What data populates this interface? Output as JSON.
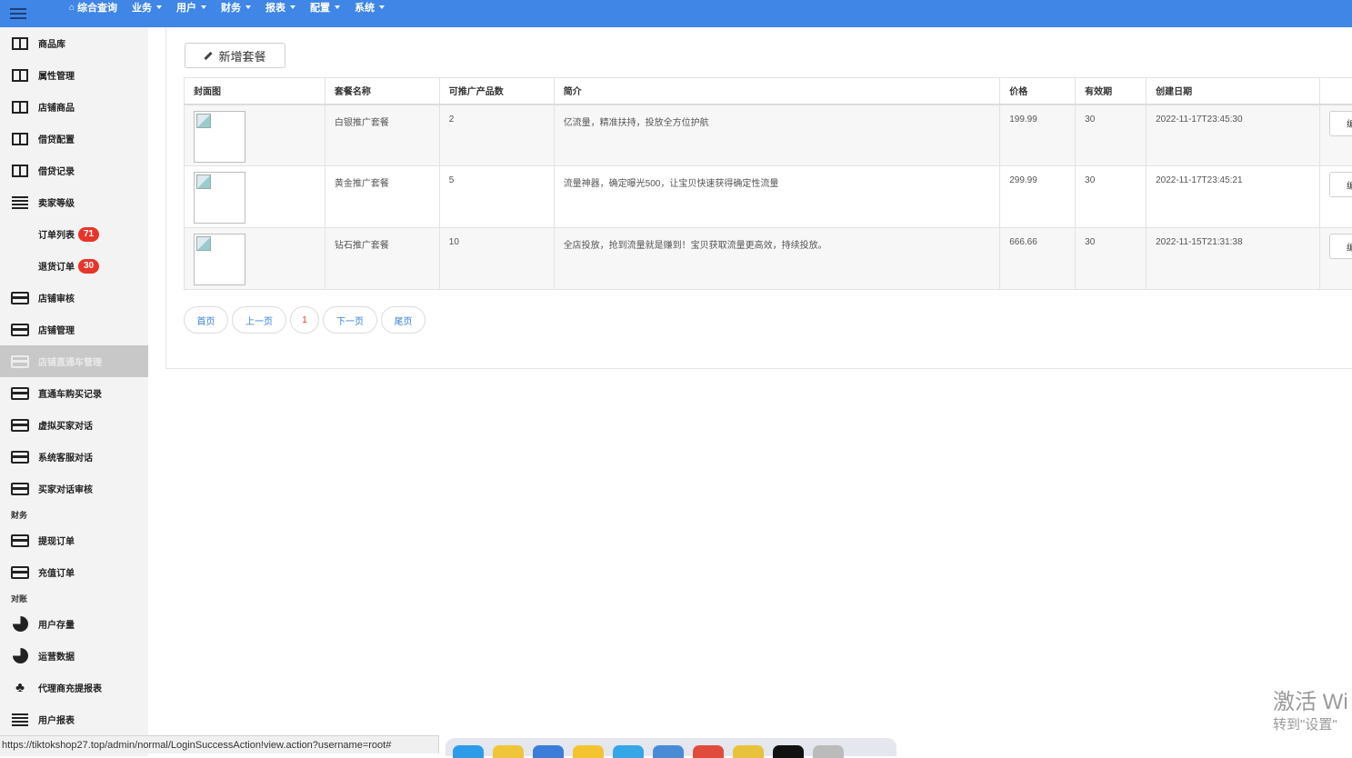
{
  "topnav": {
    "items": [
      {
        "label": "综合查询",
        "has_home_icon": true,
        "has_caret": false
      },
      {
        "label": "业务",
        "has_caret": true
      },
      {
        "label": "用户",
        "has_caret": true
      },
      {
        "label": "财务",
        "has_caret": true
      },
      {
        "label": "报表",
        "has_caret": true
      },
      {
        "label": "配置",
        "has_caret": true
      },
      {
        "label": "系统",
        "has_caret": true
      }
    ]
  },
  "sidebar": {
    "items": [
      {
        "label": "商品库",
        "icon": "book-icon"
      },
      {
        "label": "属性管理",
        "icon": "book-icon"
      },
      {
        "label": "店铺商品",
        "icon": "book-icon"
      },
      {
        "label": "借贷配置",
        "icon": "book-icon"
      },
      {
        "label": "借贷记录",
        "icon": "book-icon"
      },
      {
        "label": "卖家等级",
        "icon": "list-icon"
      },
      {
        "label": "订单列表",
        "badge": "71"
      },
      {
        "label": "退货订单",
        "badge": "30"
      },
      {
        "label": "店铺审核",
        "icon": "card-icon"
      },
      {
        "label": "店铺管理",
        "icon": "card-icon"
      },
      {
        "label": "店铺直通车管理",
        "icon": "card-icon",
        "active": true
      },
      {
        "label": "直通车购买记录",
        "icon": "card-icon"
      },
      {
        "label": "虚拟买家对话",
        "icon": "card-icon"
      },
      {
        "label": "系统客服对话",
        "icon": "card-icon"
      },
      {
        "label": "买家对话审核",
        "icon": "card-icon"
      },
      {
        "section": "财务"
      },
      {
        "label": "提现订单",
        "icon": "card-icon"
      },
      {
        "label": "充值订单",
        "icon": "card-icon"
      },
      {
        "section": "对账"
      },
      {
        "label": "用户存量",
        "icon": "pie-icon"
      },
      {
        "label": "运营数据",
        "icon": "pie-icon"
      },
      {
        "label": "代理商充提报表",
        "icon": "sitemap-icon"
      },
      {
        "label": "用户报表",
        "icon": "list-icon"
      }
    ]
  },
  "toolbar": {
    "add_label": "新增套餐"
  },
  "table": {
    "headers": [
      "封面图",
      "套餐名称",
      "可推广产品数",
      "简介",
      "价格",
      "有效期",
      "创建日期",
      ""
    ],
    "rows": [
      {
        "name": "白银推广套餐",
        "count": "2",
        "intro": "亿流量，精准扶持，投放全方位护航",
        "price": "199.99",
        "validity": "30",
        "created": "2022-11-17T23:45:30",
        "op": "编"
      },
      {
        "name": "黄金推广套餐",
        "count": "5",
        "intro": "流量神器，确定曝光500，让宝贝快速获得确定性流量",
        "price": "299.99",
        "validity": "30",
        "created": "2022-11-17T23:45:21",
        "op": "编"
      },
      {
        "name": "钻石推广套餐",
        "count": "10",
        "intro": "全店投放，抢到流量就是赚到！宝贝获取流量更高效，持续投放。",
        "price": "666.66",
        "validity": "30",
        "created": "2022-11-15T21:31:38",
        "op": "编"
      }
    ]
  },
  "pager": {
    "first": "首页",
    "prev": "上一页",
    "current": "1",
    "next": "下一页",
    "last": "尾页"
  },
  "status_url": "https://tiktokshop27.top/admin/normal/LoginSuccessAction!view.action?username=root#",
  "watermark": {
    "line1": "激活 Wi",
    "line2": "转到\"设置\""
  },
  "colors": {
    "topbar": "#3f86e6",
    "badge": "#e8352a",
    "link": "#3a7fd5"
  }
}
